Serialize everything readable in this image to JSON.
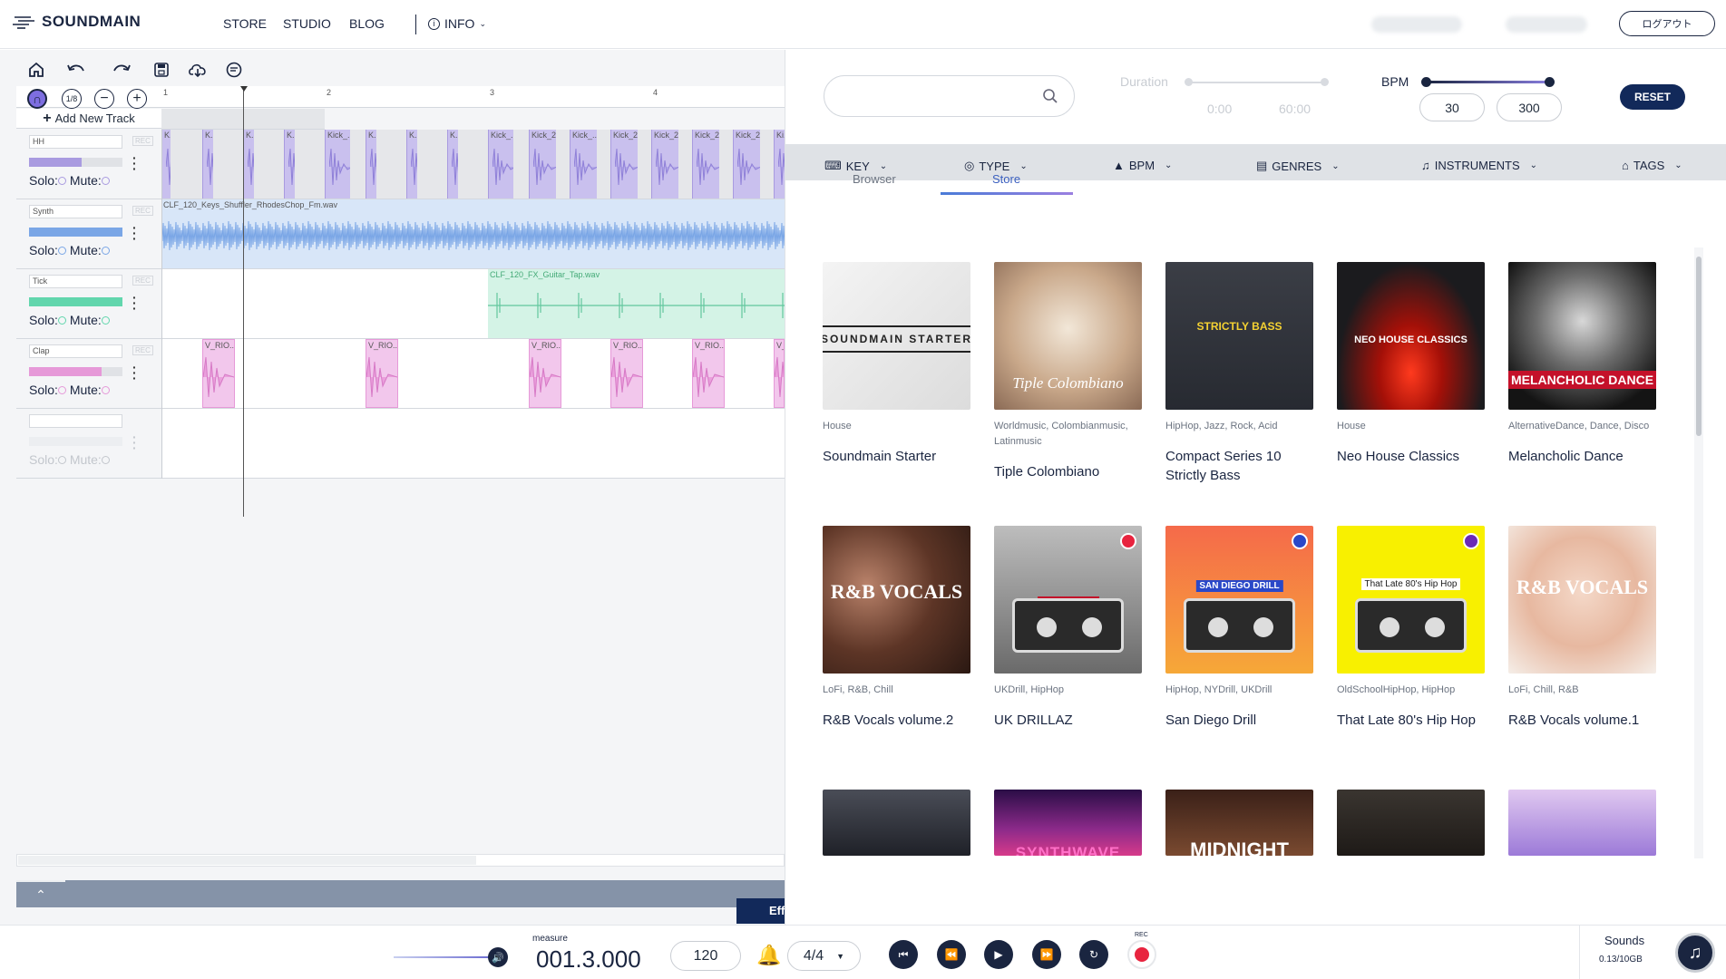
{
  "nav": {
    "logo": "SOUNDMAIN",
    "store": "STORE",
    "studio": "STUDIO",
    "blog": "BLOG",
    "info": "INFO",
    "logout": "ログアウト"
  },
  "tracks": [
    {
      "name": "HH",
      "rec": "REC",
      "solo": "Solo:",
      "mute": "Mute:",
      "color": "#a99be0"
    },
    {
      "name": "Synth",
      "rec": "REC",
      "solo": "Solo:",
      "mute": "Mute:",
      "color": "#7aa6e6"
    },
    {
      "name": "Tick",
      "rec": "REC",
      "solo": "Solo:",
      "mute": "Mute:",
      "color": "#62d6ad"
    },
    {
      "name": "Clap",
      "rec": "REC",
      "solo": "Solo:",
      "mute": "Mute:",
      "color": "#e699d8"
    },
    {
      "name": "",
      "rec": "",
      "solo": "Solo:",
      "mute": "Mute:",
      "color": "#cccccc"
    }
  ],
  "daw": {
    "add_track": "Add New Track",
    "snap": "1/8",
    "ruler": [
      "1",
      "2",
      "3",
      "4"
    ],
    "effect_tab": "Eff"
  },
  "clips": {
    "hh": [
      "K..",
      "K..",
      "K..",
      "K..",
      "Kick_..",
      "K..",
      "K..",
      "K..",
      "Kick_..",
      "Kick_2..",
      "Kick_..",
      "Kick_2..",
      "Kick_2..",
      "Kick_2..",
      "Kick_2..",
      "Ki.."
    ],
    "synth": "CLF_120_Keys_Shuffler_RhodesChop_Fm.wav",
    "tick": "CLF_120_FX_Guitar_Tap.wav",
    "clap": [
      "V_RIO...",
      "V_RIO...",
      "V_RIO...",
      "V_RIO...",
      "V_RIO...",
      "V_.."
    ]
  },
  "filters": {
    "duration_label": "Duration",
    "duration_min": "0:00",
    "duration_max": "60:00",
    "bpm_label": "BPM",
    "bpm_min": "30",
    "bpm_max": "300",
    "reset": "RESET",
    "key": "KEY",
    "type": "TYPE",
    "bpm": "BPM",
    "genres": "GENRES",
    "instruments": "INSTRUMENTS",
    "tags": "TAGS"
  },
  "tabs": {
    "browser": "Browser",
    "store": "Store"
  },
  "cards": [
    {
      "genre": "House",
      "title": "Soundmain Starter",
      "art_text": "SOUNDMAIN STARTER"
    },
    {
      "genre": "Worldmusic, Colombianmusic, Latinmusic",
      "title": "Tiple Colombiano",
      "art_text": "Tiple Colombiano"
    },
    {
      "genre": "HipHop, Jazz, Rock, Acid",
      "title": "Compact Series 10 Strictly Bass",
      "art_text": "STRICTLY BASS"
    },
    {
      "genre": "House",
      "title": "Neo House Classics",
      "art_text": "NEO HOUSE CLASSICS"
    },
    {
      "genre": "AlternativeDance, Dance, Disco",
      "title": "Melancholic Dance",
      "art_text": "MELANCHOLIC DANCE"
    },
    {
      "genre": "LoFi, R&B, Chill",
      "title": "R&B Vocals volume.2",
      "art_text": "R&B VOCALS"
    },
    {
      "genre": "UKDrill, HipHop",
      "title": "UK DRILLAZ",
      "art_text": "UK DRILLAZ"
    },
    {
      "genre": "HipHop, NYDrill, UKDrill",
      "title": "San Diego Drill",
      "art_text": "SAN DIEGO DRILL"
    },
    {
      "genre": "OldSchoolHipHop, HipHop",
      "title": "That Late 80's Hip Hop",
      "art_text": "That Late 80's Hip Hop"
    },
    {
      "genre": "LoFi, Chill, R&B",
      "title": "R&B Vocals volume.1",
      "art_text": "R&B VOCALS"
    },
    {
      "genre": "",
      "title": "",
      "art_text": ""
    },
    {
      "genre": "",
      "title": "",
      "art_text": "SYNTHWAVE"
    },
    {
      "genre": "",
      "title": "",
      "art_text": "MIDNIGHT"
    },
    {
      "genre": "",
      "title": "",
      "art_text": ""
    },
    {
      "genre": "",
      "title": "",
      "art_text": ""
    }
  ],
  "transport": {
    "measure_label": "measure",
    "measure": "001.3.000",
    "tempo": "120",
    "time_sig": "4/4",
    "rec": "REC",
    "sounds_label": "Sounds",
    "sounds_usage": "0.13/10GB"
  }
}
